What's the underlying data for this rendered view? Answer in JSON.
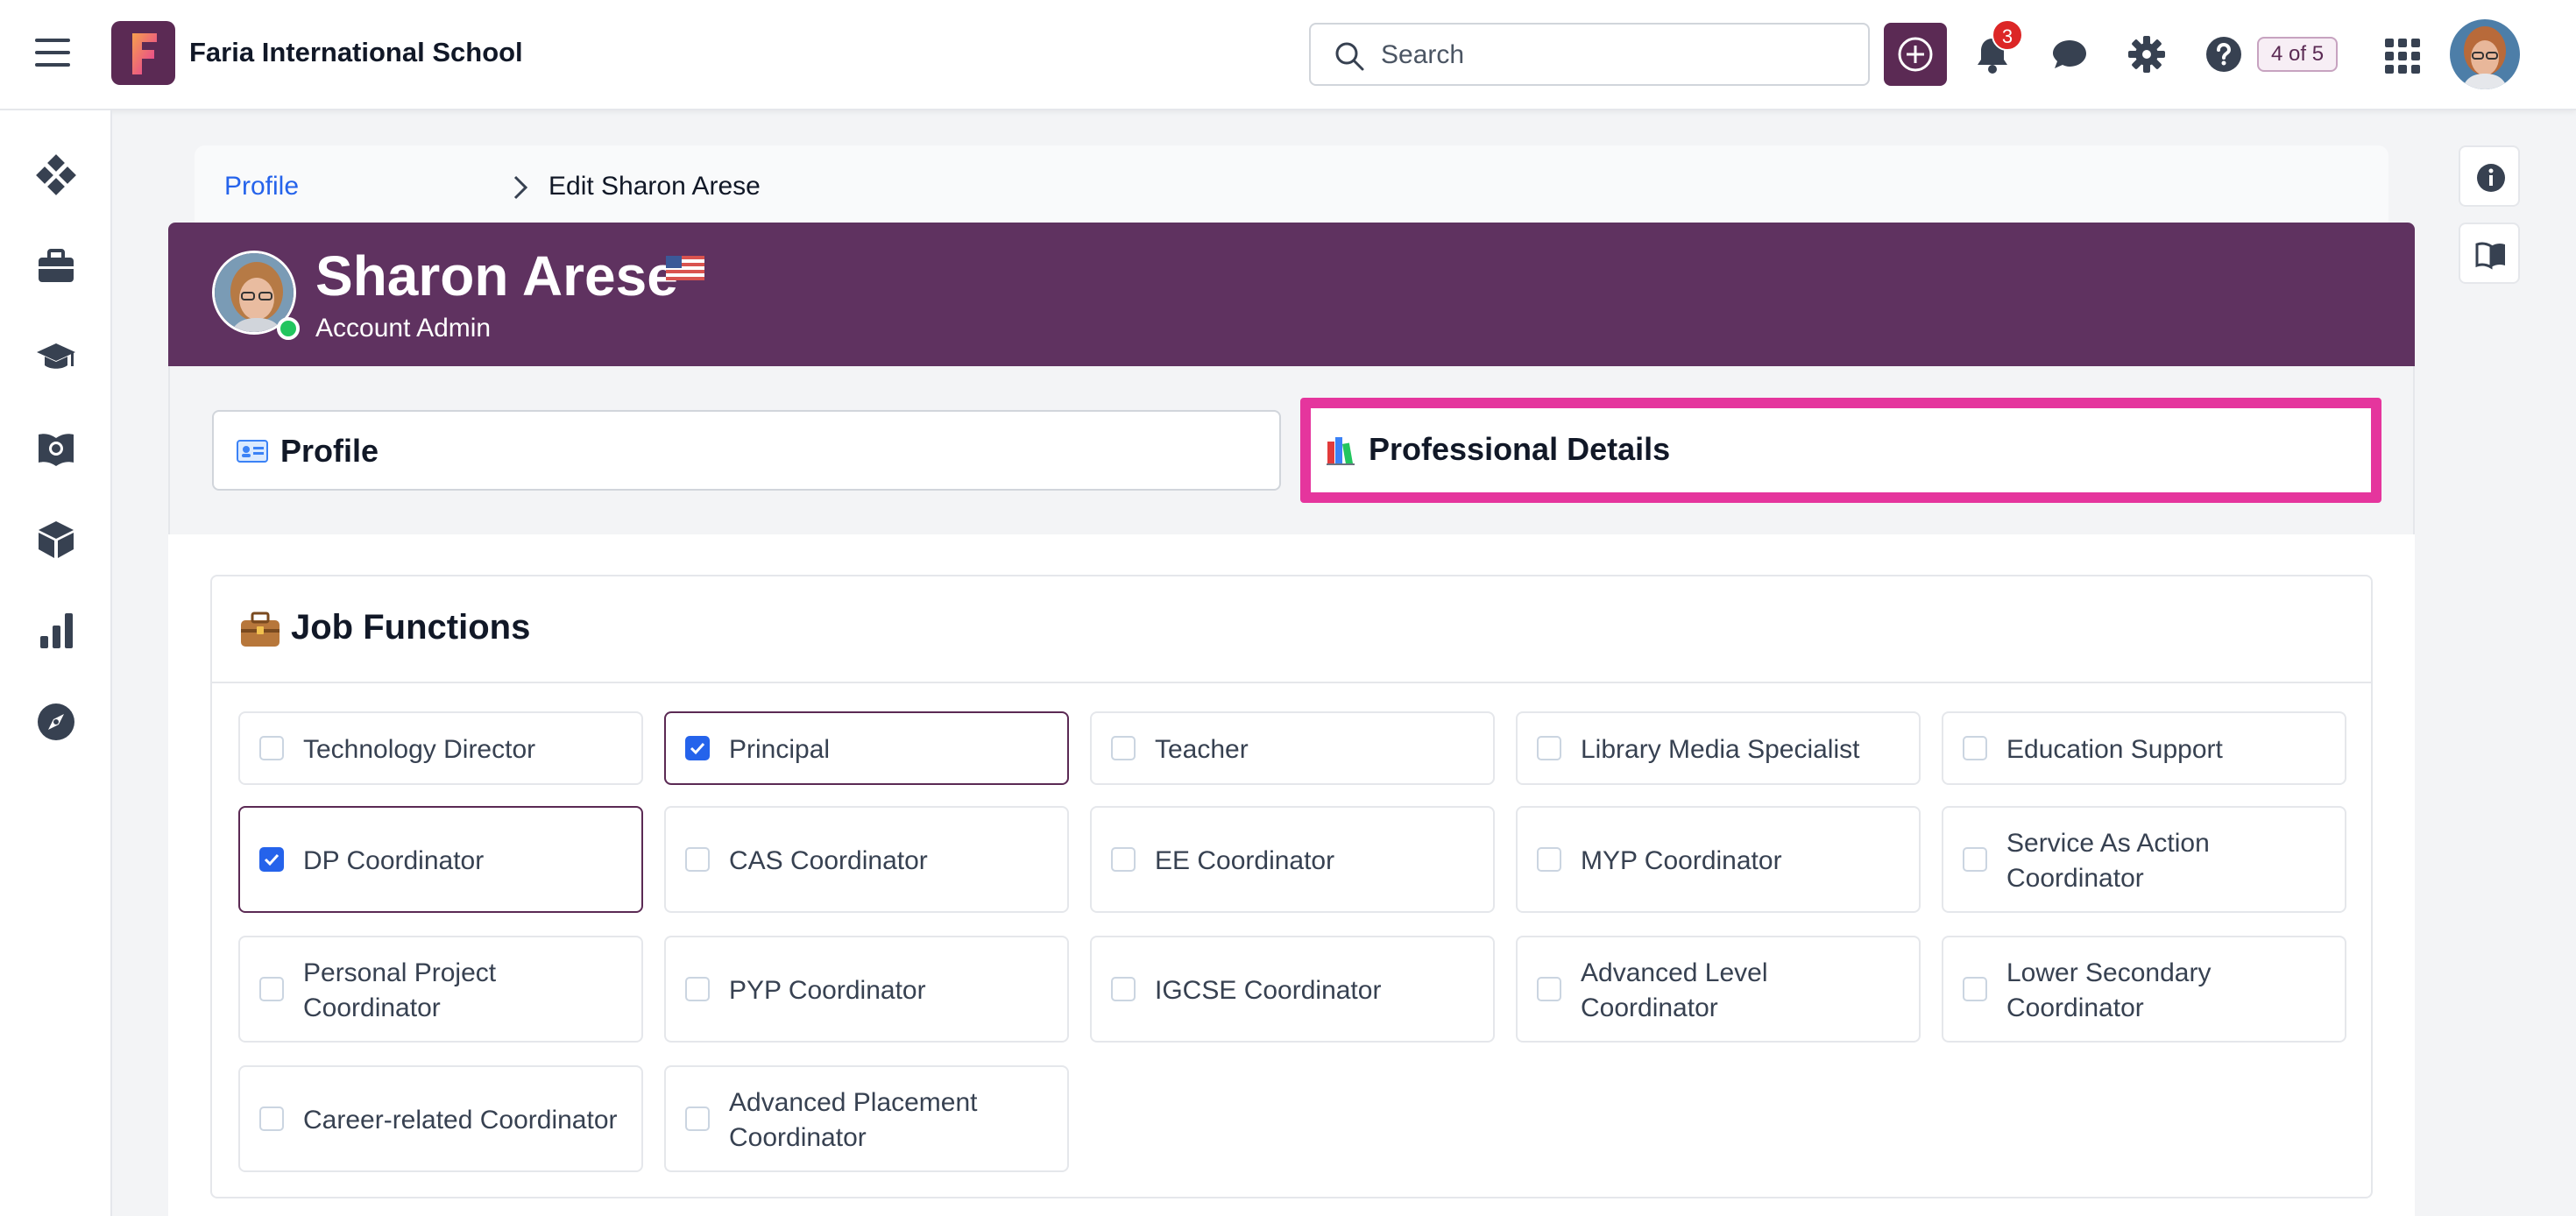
{
  "topbar": {
    "school_name": "Faria International School",
    "search_placeholder": "Search",
    "notification_count": "3",
    "page_count": "4 of 5"
  },
  "breadcrumb": {
    "link": "Profile",
    "current": "Edit Sharon Arese"
  },
  "profile": {
    "name": "Sharon Arese",
    "role": "Account Admin",
    "status": "online"
  },
  "tabs": [
    {
      "label": "Profile",
      "active": false
    },
    {
      "label": "Professional Details",
      "active": true
    }
  ],
  "job_functions": {
    "title": "Job Functions",
    "options": [
      {
        "label": "Technology Director",
        "checked": false
      },
      {
        "label": "Principal",
        "checked": true
      },
      {
        "label": "Teacher",
        "checked": false
      },
      {
        "label": "Library Media Specialist",
        "checked": false
      },
      {
        "label": "Education Support",
        "checked": false
      },
      {
        "label": "DP Coordinator",
        "checked": true
      },
      {
        "label": "CAS Coordinator",
        "checked": false
      },
      {
        "label": "EE Coordinator",
        "checked": false
      },
      {
        "label": "MYP Coordinator",
        "checked": false
      },
      {
        "label": "Service As Action Coordinator",
        "checked": false
      },
      {
        "label": "Personal Project Coordinator",
        "checked": false
      },
      {
        "label": "PYP Coordinator",
        "checked": false
      },
      {
        "label": "IGCSE Coordinator",
        "checked": false
      },
      {
        "label": "Advanced Level Coordinator",
        "checked": false
      },
      {
        "label": "Lower Secondary Coordinator",
        "checked": false
      },
      {
        "label": "Career-related Coordinator",
        "checked": false
      },
      {
        "label": "Advanced Placement Coordinator",
        "checked": false
      }
    ]
  },
  "colors": {
    "brand": "#5b2a54",
    "banner": "#5f3260",
    "highlight": "#e5359d",
    "checkbox": "#2563eb",
    "link": "#2563eb",
    "badge": "#dc2626"
  }
}
